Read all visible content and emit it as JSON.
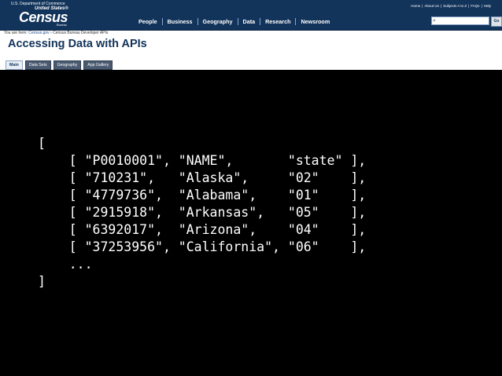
{
  "header": {
    "department": "U.S. Department of Commerce",
    "logo": {
      "small": "United States®",
      "big": "Census",
      "bureau": "Bureau"
    },
    "utility_links": [
      "Home",
      "About Us",
      "Subjects A to Z",
      "FAQs",
      "Help"
    ],
    "nav": [
      "People",
      "Business",
      "Geography",
      "Data",
      "Research",
      "Newsroom"
    ],
    "search": {
      "value": "",
      "placeholder": "",
      "go_label": "Go"
    }
  },
  "breadcrumb": {
    "prefix": "You are here:",
    "link": "Census.gov",
    "sep": "›",
    "current": "Census Bureau Developer APIs"
  },
  "page": {
    "title": "Accessing Data with APIs"
  },
  "tabs": [
    {
      "label": "Main",
      "active": true
    },
    {
      "label": "Data Sets",
      "active": false
    },
    {
      "label": "Geography",
      "active": false
    },
    {
      "label": "App Gallery",
      "active": false
    }
  ],
  "code_lines": [
    "[",
    "    [ \"P0010001\", \"NAME\",       \"state\" ],",
    "    [ \"710231\",   \"Alaska\",     \"02\"    ],",
    "    [ \"4779736\",  \"Alabama\",    \"01\"    ],",
    "    [ \"2915918\",  \"Arkansas\",   \"05\"    ],",
    "    [ \"6392017\",  \"Arizona\",    \"04\"    ],",
    "    [ \"37253956\", \"California\", \"06\"    ],",
    "    ...",
    "]"
  ]
}
